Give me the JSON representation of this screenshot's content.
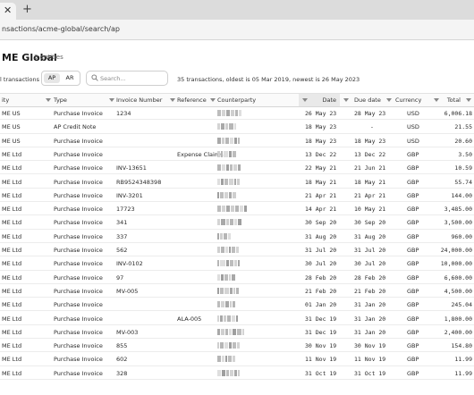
{
  "browser": {
    "tab_close": "✕",
    "new_tab": "+",
    "url": "nsactions/acme-global/search/ap"
  },
  "header": {
    "title": "ME Global",
    "entities": "3 entities"
  },
  "toolbar": {
    "filter_label": "l transactions",
    "ap_label": "AP",
    "ar_label": "AR",
    "search_placeholder": "Search...",
    "summary": "35 transactions, oldest is 05 Mar 2019, newest is 26 May 2023"
  },
  "table": {
    "headers": {
      "entity": "ity",
      "type": "Type",
      "invoice": "Invoice Number",
      "reference": "Reference",
      "counterparty": "Counterparty",
      "date": "Date",
      "due": "Due date",
      "currency": "Currency",
      "total": "Total"
    },
    "rows": [
      {
        "entity": "ME US",
        "type": "Purchase Invoice",
        "invoice": "1234",
        "reference": "",
        "date": "26 May 23",
        "due": "28 May 23",
        "currency": "USD",
        "total": "6,006.18"
      },
      {
        "entity": "ME US",
        "type": "AP Credit Note",
        "invoice": "",
        "reference": "",
        "date": "18 May 23",
        "due": "-",
        "currency": "USD",
        "total": "21.55"
      },
      {
        "entity": "ME US",
        "type": "Purchase Invoice",
        "invoice": "",
        "reference": "",
        "date": "18 May 23",
        "due": "18 May 23",
        "currency": "USD",
        "total": "20.60"
      },
      {
        "entity": "ME Ltd",
        "type": "Purchase Invoice",
        "invoice": "",
        "reference": "Expense Claims",
        "date": "13 Dec 22",
        "due": "13 Dec 22",
        "currency": "GBP",
        "total": "3.50"
      },
      {
        "entity": "ME Ltd",
        "type": "Purchase Invoice",
        "invoice": "INV-13651",
        "reference": "",
        "date": "22 May 21",
        "due": "21 Jun 21",
        "currency": "GBP",
        "total": "10.59"
      },
      {
        "entity": "ME Ltd",
        "type": "Purchase Invoice",
        "invoice": "RB9524348398",
        "reference": "",
        "date": "18 May 21",
        "due": "18 May 21",
        "currency": "GBP",
        "total": "55.74"
      },
      {
        "entity": "ME Ltd",
        "type": "Purchase Invoice",
        "invoice": "INV-3201",
        "reference": "",
        "date": "21 Apr 21",
        "due": "21 Apr 21",
        "currency": "GBP",
        "total": "144.00"
      },
      {
        "entity": "ME Ltd",
        "type": "Purchase Invoice",
        "invoice": "17723",
        "reference": "",
        "date": "14 Apr 21",
        "due": "10 May 21",
        "currency": "GBP",
        "total": "3,485.00"
      },
      {
        "entity": "ME Ltd",
        "type": "Purchase Invoice",
        "invoice": "341",
        "reference": "",
        "date": "30 Sep 20",
        "due": "30 Sep 20",
        "currency": "GBP",
        "total": "3,500.00"
      },
      {
        "entity": "ME Ltd",
        "type": "Purchase Invoice",
        "invoice": "337",
        "reference": "",
        "date": "31 Aug 20",
        "due": "31 Aug 20",
        "currency": "GBP",
        "total": "960.00"
      },
      {
        "entity": "ME Ltd",
        "type": "Purchase Invoice",
        "invoice": "562",
        "reference": "",
        "date": "31 Jul 20",
        "due": "31 Jul 20",
        "currency": "GBP",
        "total": "24,000.00"
      },
      {
        "entity": "ME Ltd",
        "type": "Purchase Invoice",
        "invoice": "INV-0102",
        "reference": "",
        "date": "30 Jul 20",
        "due": "30 Jul 20",
        "currency": "GBP",
        "total": "10,000.00"
      },
      {
        "entity": "ME Ltd",
        "type": "Purchase Invoice",
        "invoice": "97",
        "reference": "",
        "date": "28 Feb 20",
        "due": "28 Feb 20",
        "currency": "GBP",
        "total": "6,600.00"
      },
      {
        "entity": "ME Ltd",
        "type": "Purchase Invoice",
        "invoice": "MV-005",
        "reference": "",
        "date": "21 Feb 20",
        "due": "21 Feb 20",
        "currency": "GBP",
        "total": "4,500.00"
      },
      {
        "entity": "ME Ltd",
        "type": "Purchase Invoice",
        "invoice": "",
        "reference": "",
        "date": "01 Jan 20",
        "due": "31 Jan 20",
        "currency": "GBP",
        "total": "245.04"
      },
      {
        "entity": "ME Ltd",
        "type": "Purchase Invoice",
        "invoice": "",
        "reference": "ALA-005",
        "date": "31 Dec 19",
        "due": "31 Jan 20",
        "currency": "GBP",
        "total": "1,800.00"
      },
      {
        "entity": "ME Ltd",
        "type": "Purchase Invoice",
        "invoice": "MV-003",
        "reference": "",
        "date": "31 Dec 19",
        "due": "31 Jan 20",
        "currency": "GBP",
        "total": "2,400.00"
      },
      {
        "entity": "ME Ltd",
        "type": "Purchase Invoice",
        "invoice": "855",
        "reference": "",
        "date": "30 Nov 19",
        "due": "30 Nov 19",
        "currency": "GBP",
        "total": "154.80"
      },
      {
        "entity": "ME Ltd",
        "type": "Purchase Invoice",
        "invoice": "602",
        "reference": "",
        "date": "11 Nov 19",
        "due": "11 Nov 19",
        "currency": "GBP",
        "total": "11.99"
      },
      {
        "entity": "ME Ltd",
        "type": "Purchase Invoice",
        "invoice": "328",
        "reference": "",
        "date": "31 Oct 19",
        "due": "31 Oct 19",
        "currency": "GBP",
        "total": "11.99"
      }
    ]
  }
}
